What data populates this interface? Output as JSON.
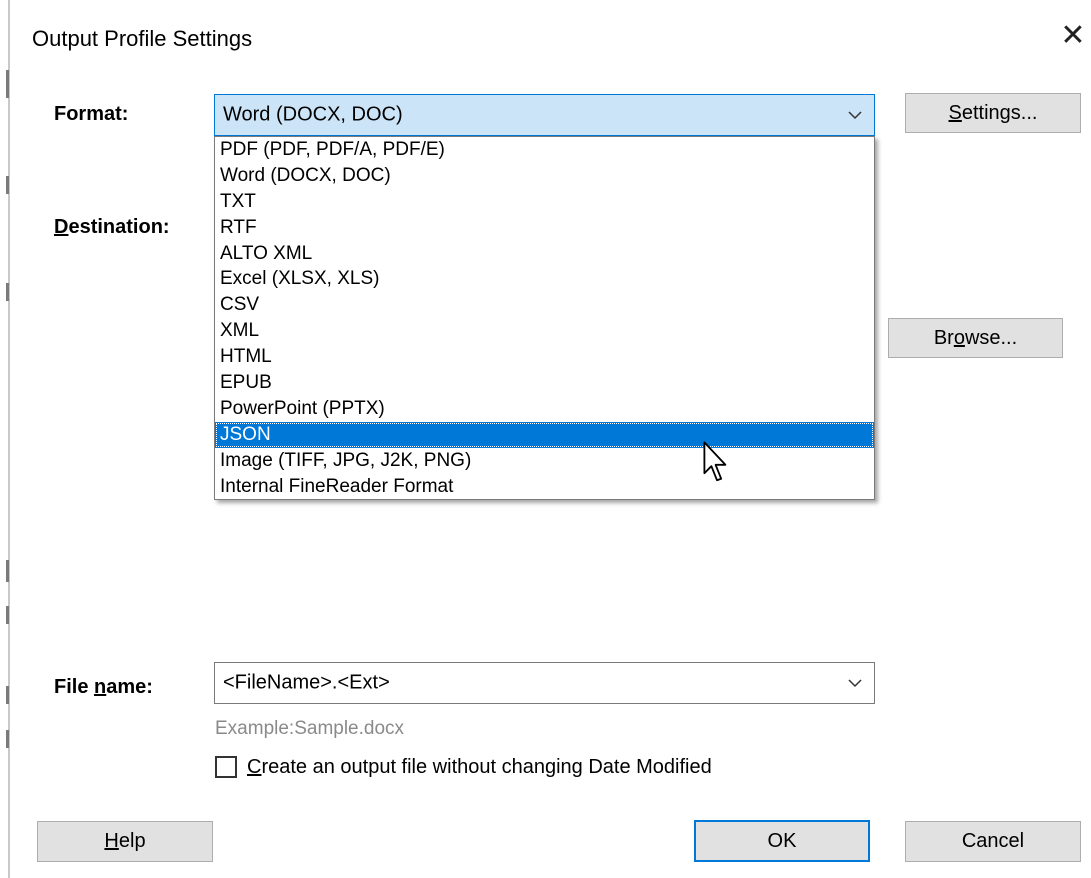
{
  "dialog": {
    "title": "Output Profile Settings",
    "close_glyph": "✕"
  },
  "format": {
    "label": "Format:",
    "selected_value": "Word (DOCX, DOC)",
    "settings_button": "Settings...",
    "settings_underline": "S",
    "settings_rest": "ettings...",
    "options": [
      "PDF (PDF, PDF/A, PDF/E)",
      "Word (DOCX, DOC)",
      "TXT",
      "RTF",
      "ALTO XML",
      "Excel (XLSX, XLS)",
      "CSV",
      "XML",
      "HTML",
      "EPUB",
      "PowerPoint (PPTX)",
      "JSON",
      "Image (TIFF, JPG, J2K, PNG)",
      "Internal FineReader Format"
    ],
    "highlighted_option": "JSON"
  },
  "destination": {
    "label_underline": "D",
    "label_rest": "estination:",
    "browse_pre": "Br",
    "browse_underline": "o",
    "browse_post": "wse..."
  },
  "file_name": {
    "label_pre": "File ",
    "label_underline": "n",
    "label_post": "ame:",
    "value": "<FileName>.<Ext>",
    "example": "Example:Sample.docx"
  },
  "checkbox": {
    "checked": false,
    "label_underline": "C",
    "label_rest": "reate an output file without changing Date Modified"
  },
  "buttons": {
    "help_underline": "H",
    "help_rest": "elp",
    "ok": "OK",
    "cancel": "Cancel"
  },
  "icons": {
    "close": "close-icon",
    "chevron": "chevron-down-icon",
    "cursor": "mouse-pointer-icon"
  },
  "colors": {
    "accent": "#0078d7",
    "combo_focus_bg": "#cce4f7",
    "button_bg": "#e1e1e1",
    "example_text": "#8a8a8a"
  }
}
